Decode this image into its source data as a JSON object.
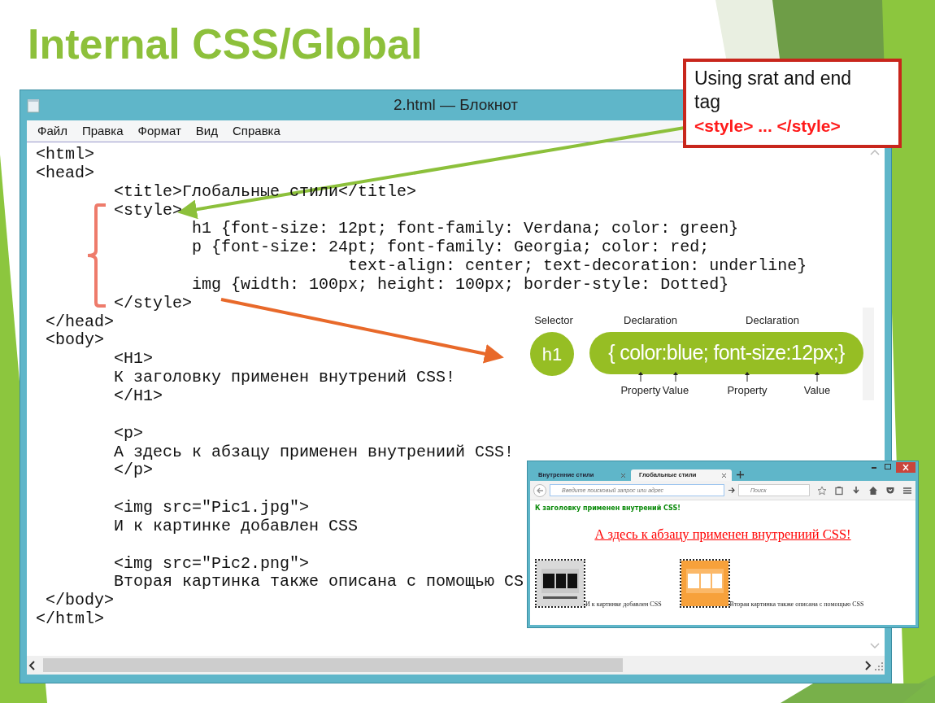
{
  "slide_title": "Internal CSS/Global",
  "notepad": {
    "title": "2.html — Блокнот",
    "menu": [
      "Файл",
      "Правка",
      "Формат",
      "Вид",
      "Справка"
    ],
    "code_blocks": [
      [
        "<html>",
        "<head>",
        "\t<title>Глобальные стили</title>",
        "\t<style>",
        "\t\th1 {font-size: 12pt; font-family: Verdana; color: green}",
        "\t\tp {font-size: 24pt; font-family: Georgia; color: red;",
        "\t\t\t\ttext-align: center; text-decoration: underline}",
        "\t\timg {width: 100px; height: 100px; border-style: Dotted}",
        "\t</style>",
        " </head>",
        " <body>",
        "\t<H1>",
        "\tК заголовку применен внутрений CSS!",
        "\t</H1>"
      ],
      [
        "\t<p>",
        "\tА здесь к абзацу применен внутрениий CSS!",
        "\t</p>"
      ],
      [
        "\t<img src=\"Pic1.jpg\">",
        "\tИ к картинке добавлен CSS"
      ],
      [
        "\t<img src=\"Pic2.png\">",
        "\tВторая картинка также описана с помощью CS",
        " </body>",
        "</html>"
      ]
    ]
  },
  "callout": {
    "text": "Using srat and end tag",
    "code": "<style> ... </style>"
  },
  "syntax_diagram": {
    "selector_label": "Selector",
    "declaration_labels": [
      "Declaration",
      "Declaration"
    ],
    "selector": "h1",
    "rule": "{ color:blue; font-size:12px;}",
    "annotations": [
      "Property",
      "Value",
      "Property",
      "Value"
    ]
  },
  "browser": {
    "tabs": [
      {
        "label": "Внутренние стили",
        "selected": false
      },
      {
        "label": "Глобальные стили",
        "selected": true
      }
    ],
    "address_placeholder": "Введите поисковый запрос или адрес",
    "search_placeholder": "Поиск",
    "heading": "К заголовку применен внутрений CSS!",
    "paragraph": "А здесь к абзацу применен внутрениий CSS!",
    "images": [
      {
        "kind": "picture",
        "caption": "И к картинке добавлен CSS"
      },
      {
        "kind": "picture",
        "caption": "Вторая картинка также описана с помощью CSS"
      }
    ]
  }
}
